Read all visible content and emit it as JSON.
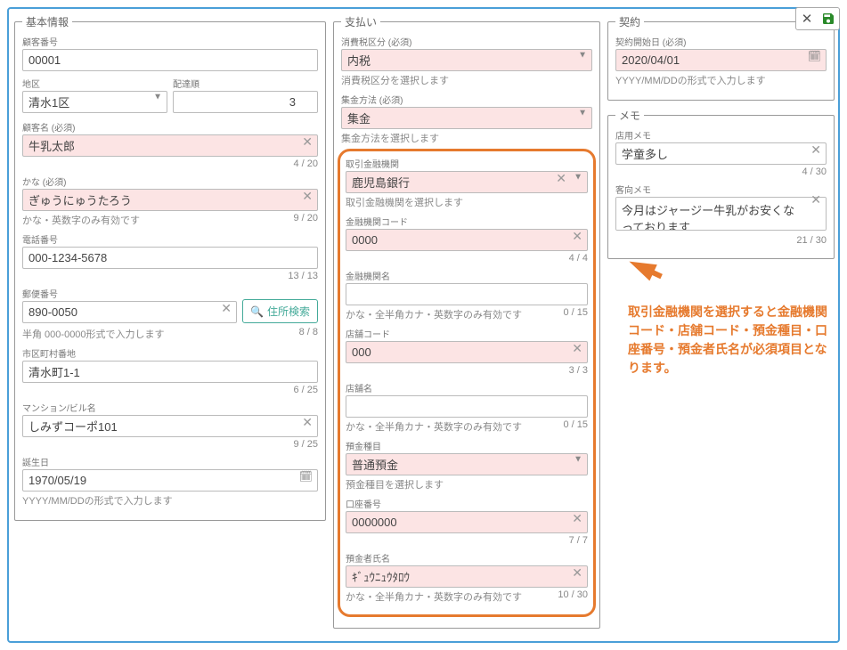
{
  "basic": {
    "legend": "基本情報",
    "custno_lbl": "顧客番号",
    "custno": "00001",
    "area_lbl": "地区",
    "area": "清水1区",
    "delorder_lbl": "配達順",
    "delorder": "3",
    "custname_lbl": "顧客名 (必須)",
    "custname": "牛乳太郎",
    "custname_count": "4 / 20",
    "kana_lbl": "かな (必須)",
    "kana": "ぎゅうにゅうたろう",
    "kana_help": "かな・英数字のみ有効です",
    "kana_count": "9 / 20",
    "tel_lbl": "電話番号",
    "tel": "000-1234-5678",
    "tel_count": "13 / 13",
    "postal_lbl": "郵便番号",
    "postal": "890-0050",
    "postal_help": "半角 000-0000形式で入力します",
    "postal_count": "8 / 8",
    "search_btn": "住所検索",
    "city_lbl": "市区町村番地",
    "city": "清水町1-1",
    "city_count": "6 / 25",
    "bldg_lbl": "マンション/ビル名",
    "bldg": "しみずコーポ101",
    "bldg_count": "9 / 25",
    "birth_lbl": "誕生日",
    "birth": "1970/05/19",
    "birth_help": "YYYY/MM/DDの形式で入力します"
  },
  "pay": {
    "legend": "支払い",
    "tax_lbl": "消費税区分 (必須)",
    "tax": "内税",
    "tax_help": "消費税区分を選択します",
    "method_lbl": "集金方法 (必須)",
    "method": "集金",
    "method_help": "集金方法を選択します",
    "bank_lbl": "取引金融機関",
    "bank": "鹿児島銀行",
    "bank_help": "取引金融機関を選択します",
    "bankcode_lbl": "金融機関コード",
    "bankcode": "0000",
    "bankcode_count": "4 / 4",
    "bankname_lbl": "金融機関名",
    "bankname": "",
    "bankname_help": "かな・全半角カナ・英数字のみ有効です",
    "bankname_count": "0 / 15",
    "branchcode_lbl": "店舗コード",
    "branchcode": "000",
    "branchcode_count": "3 / 3",
    "branchname_lbl": "店舗名",
    "branchname": "",
    "branchname_help": "かな・全半角カナ・英数字のみ有効です",
    "branchname_count": "0 / 15",
    "deposit_lbl": "預金種目",
    "deposit": "普通預金",
    "deposit_help": "預金種目を選択します",
    "acctno_lbl": "口座番号",
    "acctno": "0000000",
    "acctno_count": "7 / 7",
    "holder_lbl": "預金者氏名",
    "holder": "ｷﾞｭｳﾆｭｳﾀﾛｳ",
    "holder_help": "かな・全半角カナ・英数字のみ有効です",
    "holder_count": "10 / 30"
  },
  "contract": {
    "legend": "契約",
    "start_lbl": "契約開始日 (必須)",
    "start": "2020/04/01",
    "start_help": "YYYY/MM/DDの形式で入力します"
  },
  "memo": {
    "legend": "メモ",
    "store_lbl": "店用メモ",
    "store": "学童多し",
    "store_count": "4 / 30",
    "cust_lbl": "客向メモ",
    "cust": "今月はジャージー牛乳がお安くなっております",
    "cust_count": "21 / 30"
  },
  "annotation": "取引金融機関を選択すると金融機関コード・店舗コード・預金種目・口座番号・預金者氏名が必須項目となります。"
}
